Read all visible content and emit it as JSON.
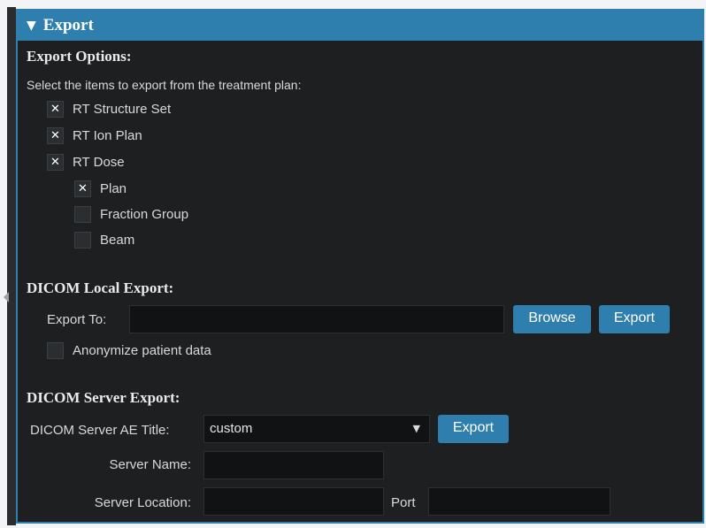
{
  "panel": {
    "title": "Export",
    "collapse_glyph": "▼"
  },
  "export_options": {
    "title": "Export Options:",
    "instruction": "Select the items to export from the treatment plan:",
    "items": [
      {
        "label": "RT Structure Set",
        "checked": true
      },
      {
        "label": "RT Ion Plan",
        "checked": true
      },
      {
        "label": "RT Dose",
        "checked": true
      }
    ],
    "dose_items": [
      {
        "label": "Plan",
        "checked": true
      },
      {
        "label": "Fraction Group",
        "checked": false
      },
      {
        "label": "Beam",
        "checked": false
      }
    ],
    "check_glyph": "✕"
  },
  "local_export": {
    "title": "DICOM Local Export:",
    "export_to_label": "Export To:",
    "export_to_value": "",
    "browse_label": "Browse",
    "export_label": "Export",
    "anonymize_label": "Anonymize patient data",
    "anonymize_checked": false
  },
  "server_export": {
    "title": "DICOM Server Export:",
    "ae_title_label": "DICOM Server AE Title:",
    "ae_title_value": "custom",
    "export_label": "Export",
    "server_name_label": "Server Name:",
    "server_name_value": "",
    "server_location_label": "Server Location:",
    "server_location_value": "",
    "port_label": "Port",
    "port_value": ""
  },
  "colors": {
    "accent": "#2f7fae",
    "panel_bg": "#1d1f21",
    "text": "#d7dadd"
  }
}
